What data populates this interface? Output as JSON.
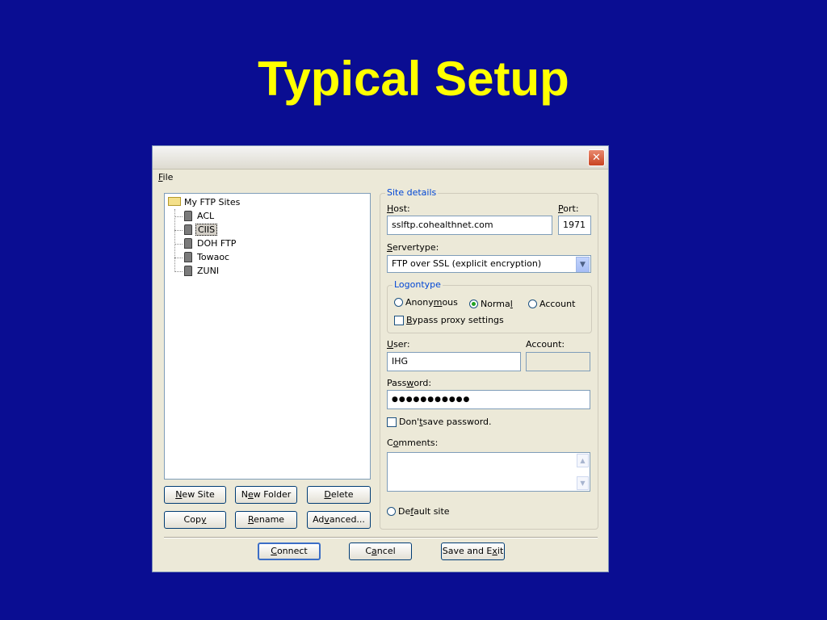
{
  "slide": {
    "title": "Typical Setup"
  },
  "window": {
    "close_glyph": "✕"
  },
  "menu": {
    "file": {
      "first": "F",
      "rest": "ile"
    }
  },
  "tree": {
    "root": "My FTP Sites",
    "items": [
      {
        "label": "ACL",
        "selected": false
      },
      {
        "label": "CIIS",
        "selected": true
      },
      {
        "label": "DOH FTP",
        "selected": false
      },
      {
        "label": "Towaoc",
        "selected": false
      },
      {
        "label": "ZUNI",
        "selected": false
      }
    ]
  },
  "buttons": {
    "new_site": {
      "u": "N",
      "rest": "ew Site"
    },
    "new_folder": {
      "pre": "N",
      "u": "e",
      "rest": "w Folder"
    },
    "delete": {
      "u": "D",
      "rest": "elete"
    },
    "copy": {
      "pre": "Cop",
      "u": "y",
      "rest": ""
    },
    "rename": {
      "u": "R",
      "rest": "ename"
    },
    "advanced": {
      "pre": "Ad",
      "u": "v",
      "rest": "anced..."
    },
    "connect": {
      "u": "C",
      "rest": "onnect"
    },
    "cancel": {
      "pre": "C",
      "u": "a",
      "rest": "ncel"
    },
    "save_exit": {
      "pre": "Save and E",
      "u": "x",
      "rest": "it"
    }
  },
  "site_details": {
    "legend": "Site details",
    "host_label": {
      "u": "H",
      "rest": "ost:"
    },
    "host_value": "sslftp.cohealthnet.com",
    "port_label": {
      "u": "P",
      "rest": "ort:"
    },
    "port_value": "1971",
    "servertype_label": {
      "u": "S",
      "rest": "ervertype:"
    },
    "servertype_value": "FTP over SSL (explicit encryption)",
    "logontype": {
      "legend": "Logontype",
      "anonymous": {
        "pre": "Anony",
        "u": "m",
        "rest": "ous"
      },
      "normal": {
        "pre": "Norma",
        "u": "l",
        "rest": ""
      },
      "account": "Account",
      "selected": "normal",
      "bypass": {
        "u": "B",
        "rest": "ypass proxy settings"
      }
    },
    "user_label": {
      "u": "U",
      "rest": "ser:"
    },
    "user_value": "IHG",
    "account_label": "Account:",
    "password_label": {
      "pre": "Pass",
      "u": "w",
      "rest": "ord:"
    },
    "password_value": "●●●●●●●●●●●",
    "dont_save": {
      "pre": "Don'",
      "u": "t",
      "rest": " save password."
    },
    "comments_label": {
      "pre": "C",
      "u": "o",
      "rest": "mments:"
    },
    "default_site": {
      "pre": "De",
      "u": "f",
      "rest": "ault site"
    }
  },
  "icons": {
    "close": "close-icon",
    "folder": "folder-icon",
    "server": "server-icon",
    "dropdown": "chevron-down-icon"
  }
}
